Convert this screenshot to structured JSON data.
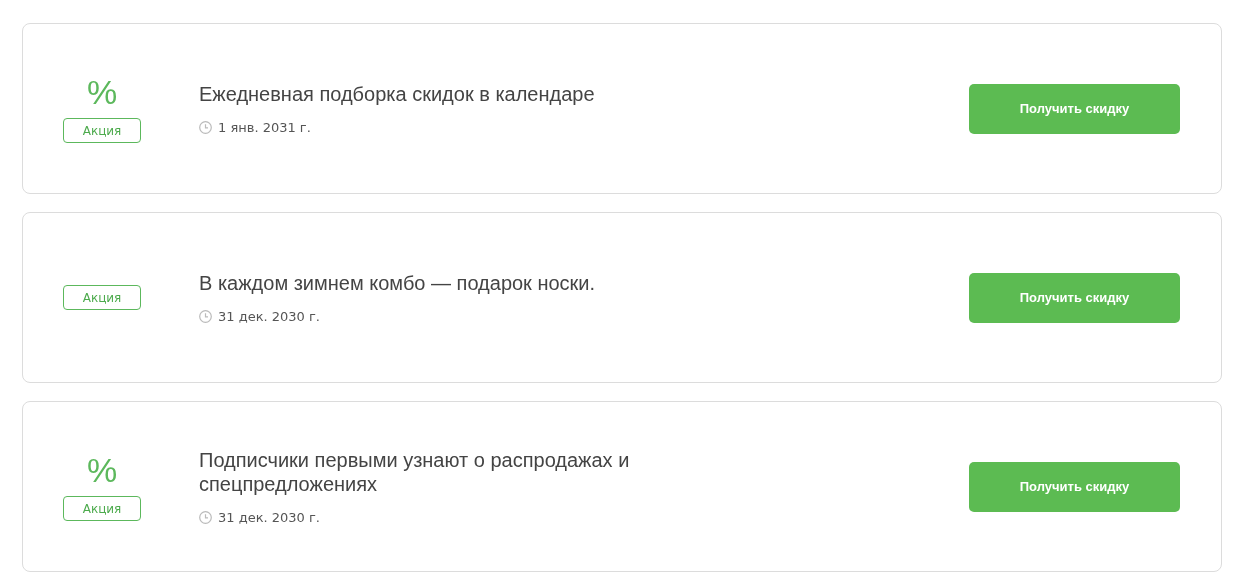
{
  "promotions": [
    {
      "sign": "%",
      "badge": "Акция",
      "title": "Ежедневная подборка скидок в календаре",
      "date": "1 янв. 2031 г.",
      "button": "Получить скидку"
    },
    {
      "badge": "Акция",
      "title": "В каждом зимнем комбо — подарок носки.",
      "date": "31 дек. 2030 г.",
      "button": "Получить скидку"
    },
    {
      "sign": "%",
      "badge": "Акция",
      "title": "Подписчики первыми узнают о распродажах и спецпредложениях",
      "date": "31 дек. 2030 г.",
      "button": "Получить скидку"
    }
  ]
}
